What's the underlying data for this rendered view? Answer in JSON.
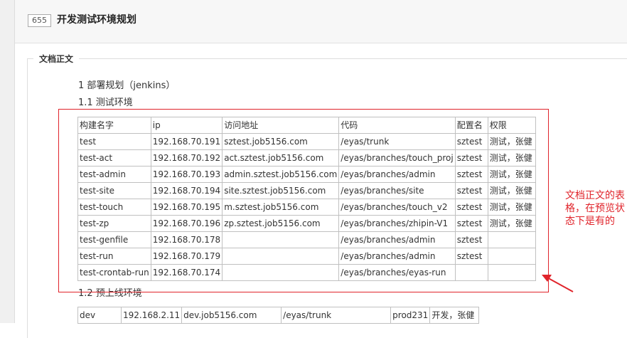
{
  "page": {
    "id_badge": "655",
    "title": "开发测试环境规划"
  },
  "doc": {
    "legend": "文档正文",
    "heading_1": "1 部署规划（jenkins）",
    "heading_1_1": "1.1 测试环境",
    "heading_1_2": "1.2 预上线环境",
    "test_table": {
      "header": [
        "构建名字",
        "ip",
        "访问地址",
        "代码",
        "配置名",
        "权限"
      ],
      "rows": [
        [
          "test",
          "192.168.70.191",
          "sztest.job5156.com",
          "/eyas/trunk",
          "sztest",
          "测试，张健"
        ],
        [
          "test-act",
          "192.168.70.192",
          "act.sztest.job5156.com",
          "/eyas/branches/touch_proj",
          "sztest",
          "测试，张健"
        ],
        [
          "test-admin",
          "192.168.70.193",
          "admin.sztest.job5156.com",
          "/eyas/branches/admin",
          "sztest",
          "测试，张健"
        ],
        [
          "test-site",
          "192.168.70.194",
          "site.sztest.job5156.com",
          "/eyas/branches/site",
          "sztest",
          "测试，张健"
        ],
        [
          "test-touch",
          "192.168.70.195",
          "m.sztest.job5156.com",
          "/eyas/branches/touch_v2",
          "sztest",
          "测试，张健"
        ],
        [
          "test-zp",
          "192.168.70.196",
          "zp.sztest.job5156.com",
          "/eyas/branches/zhipin-V1",
          "sztest",
          "测试，张健"
        ],
        [
          "test-genfile",
          "192.168.70.178",
          "",
          "/eyas/branches/admin",
          "sztest",
          ""
        ],
        [
          "test-run",
          "192.168.70.179",
          "",
          "/eyas/branches/admin",
          "sztest",
          ""
        ],
        [
          "test-crontab-run",
          "192.168.70.174",
          "",
          "/eyas/branches/eyas-run",
          "",
          ""
        ]
      ]
    },
    "preprod_table": {
      "rows": [
        [
          "dev",
          "192.168.2.11",
          "dev.job5156.com",
          "/eyas/trunk",
          "prod231",
          "开发，张健"
        ]
      ]
    }
  },
  "annotation": {
    "text": "文档正文的表格，在预览状态下是有的",
    "color": "#e0242b"
  }
}
